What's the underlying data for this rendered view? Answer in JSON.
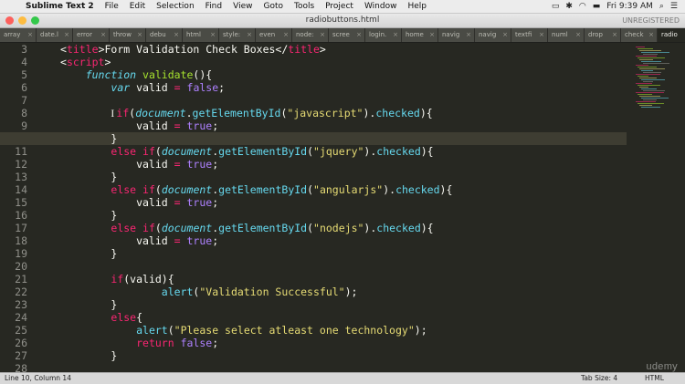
{
  "menubar": {
    "apple_icon": "apple-logo",
    "items": [
      "Sublime Text 2",
      "File",
      "Edit",
      "Selection",
      "Find",
      "View",
      "Goto",
      "Tools",
      "Project",
      "Window",
      "Help"
    ],
    "clock": "Fri 9:39 AM",
    "status_icons": [
      "display-icon",
      "bluetooth-icon",
      "wifi-icon",
      "battery-icon",
      "search-icon",
      "list-icon"
    ]
  },
  "window": {
    "title": "radiobuttons.html",
    "registration": "UNREGISTERED",
    "traffic_lights": {
      "close": "#fc605c",
      "minimize": "#fdbc40",
      "zoom": "#34c84a"
    }
  },
  "tabs": [
    {
      "label": "array",
      "active": false
    },
    {
      "label": "date.l",
      "active": false
    },
    {
      "label": "error",
      "active": false
    },
    {
      "label": "throw",
      "active": false
    },
    {
      "label": "debu",
      "active": false
    },
    {
      "label": "html",
      "active": false
    },
    {
      "label": "style:",
      "active": false
    },
    {
      "label": "even",
      "active": false
    },
    {
      "label": "node:",
      "active": false
    },
    {
      "label": "scree",
      "active": false
    },
    {
      "label": "login.",
      "active": false
    },
    {
      "label": "home",
      "active": false
    },
    {
      "label": "navig",
      "active": false
    },
    {
      "label": "navig",
      "active": false
    },
    {
      "label": "textfi",
      "active": false
    },
    {
      "label": "numl",
      "active": false
    },
    {
      "label": "drop",
      "active": false
    },
    {
      "label": "check",
      "active": false
    },
    {
      "label": "radio",
      "active": true
    }
  ],
  "editor": {
    "current_line": 10,
    "line_numbers": [
      3,
      4,
      5,
      6,
      7,
      8,
      9,
      10,
      11,
      12,
      13,
      14,
      15,
      16,
      17,
      18,
      19,
      20,
      21,
      22,
      23,
      24,
      25,
      26,
      27,
      28
    ],
    "colors": {
      "background": "#272822",
      "keyword": "#f92672",
      "function": "#a6e22e",
      "string": "#e6db74",
      "constant": "#ae81ff",
      "builtin": "#66d9ef"
    },
    "lines": [
      [
        {
          "t": "<",
          "c": ""
        },
        {
          "t": "title",
          "c": "tag"
        },
        {
          "t": ">Form Validation Check Boxes</",
          "c": ""
        },
        {
          "t": "title",
          "c": "tag"
        },
        {
          "t": ">",
          "c": ""
        }
      ],
      [
        {
          "t": "<",
          "c": ""
        },
        {
          "t": "script",
          "c": "tag"
        },
        {
          "t": ">",
          "c": ""
        }
      ],
      [
        {
          "t": "    ",
          "c": ""
        },
        {
          "t": "function",
          "c": "kwi"
        },
        {
          "t": " ",
          "c": ""
        },
        {
          "t": "validate",
          "c": "fn"
        },
        {
          "t": "(){",
          "c": ""
        }
      ],
      [
        {
          "t": "        ",
          "c": ""
        },
        {
          "t": "var",
          "c": "kwi"
        },
        {
          "t": " valid ",
          "c": ""
        },
        {
          "t": "=",
          "c": "kw"
        },
        {
          "t": " ",
          "c": ""
        },
        {
          "t": "false",
          "c": "con"
        },
        {
          "t": ";",
          "c": ""
        }
      ],
      [],
      [
        {
          "t": "        ",
          "c": ""
        },
        {
          "t": "I",
          "c": "caret"
        },
        {
          "t": "if",
          "c": "kw"
        },
        {
          "t": "(",
          "c": ""
        },
        {
          "t": "document",
          "c": "obj"
        },
        {
          "t": ".",
          "c": ""
        },
        {
          "t": "getElementById",
          "c": "meth"
        },
        {
          "t": "(",
          "c": ""
        },
        {
          "t": "\"javascript\"",
          "c": "str"
        },
        {
          "t": ").",
          "c": ""
        },
        {
          "t": "checked",
          "c": "meth"
        },
        {
          "t": "){",
          "c": ""
        }
      ],
      [
        {
          "t": "            valid ",
          "c": ""
        },
        {
          "t": "=",
          "c": "kw"
        },
        {
          "t": " ",
          "c": ""
        },
        {
          "t": "true",
          "c": "con"
        },
        {
          "t": ";",
          "c": ""
        }
      ],
      [
        {
          "t": "        }",
          "c": ""
        }
      ],
      [
        {
          "t": "        ",
          "c": ""
        },
        {
          "t": "else",
          "c": "kw"
        },
        {
          "t": " ",
          "c": ""
        },
        {
          "t": "if",
          "c": "kw"
        },
        {
          "t": "(",
          "c": ""
        },
        {
          "t": "document",
          "c": "obj"
        },
        {
          "t": ".",
          "c": ""
        },
        {
          "t": "getElementById",
          "c": "meth"
        },
        {
          "t": "(",
          "c": ""
        },
        {
          "t": "\"jquery\"",
          "c": "str"
        },
        {
          "t": ").",
          "c": ""
        },
        {
          "t": "checked",
          "c": "meth"
        },
        {
          "t": "){",
          "c": ""
        }
      ],
      [
        {
          "t": "            valid ",
          "c": ""
        },
        {
          "t": "=",
          "c": "kw"
        },
        {
          "t": " ",
          "c": ""
        },
        {
          "t": "true",
          "c": "con"
        },
        {
          "t": ";",
          "c": ""
        }
      ],
      [
        {
          "t": "        }",
          "c": ""
        }
      ],
      [
        {
          "t": "        ",
          "c": ""
        },
        {
          "t": "else",
          "c": "kw"
        },
        {
          "t": " ",
          "c": ""
        },
        {
          "t": "if",
          "c": "kw"
        },
        {
          "t": "(",
          "c": ""
        },
        {
          "t": "document",
          "c": "obj"
        },
        {
          "t": ".",
          "c": ""
        },
        {
          "t": "getElementById",
          "c": "meth"
        },
        {
          "t": "(",
          "c": ""
        },
        {
          "t": "\"angularjs\"",
          "c": "str"
        },
        {
          "t": ").",
          "c": ""
        },
        {
          "t": "checked",
          "c": "meth"
        },
        {
          "t": "){",
          "c": ""
        }
      ],
      [
        {
          "t": "            valid ",
          "c": ""
        },
        {
          "t": "=",
          "c": "kw"
        },
        {
          "t": " ",
          "c": ""
        },
        {
          "t": "true",
          "c": "con"
        },
        {
          "t": ";",
          "c": ""
        }
      ],
      [
        {
          "t": "        }",
          "c": ""
        }
      ],
      [
        {
          "t": "        ",
          "c": ""
        },
        {
          "t": "else",
          "c": "kw"
        },
        {
          "t": " ",
          "c": ""
        },
        {
          "t": "if",
          "c": "kw"
        },
        {
          "t": "(",
          "c": ""
        },
        {
          "t": "document",
          "c": "obj"
        },
        {
          "t": ".",
          "c": ""
        },
        {
          "t": "getElementById",
          "c": "meth"
        },
        {
          "t": "(",
          "c": ""
        },
        {
          "t": "\"nodejs\"",
          "c": "str"
        },
        {
          "t": ").",
          "c": ""
        },
        {
          "t": "checked",
          "c": "meth"
        },
        {
          "t": "){",
          "c": ""
        }
      ],
      [
        {
          "t": "            valid ",
          "c": ""
        },
        {
          "t": "=",
          "c": "kw"
        },
        {
          "t": " ",
          "c": ""
        },
        {
          "t": "true",
          "c": "con"
        },
        {
          "t": ";",
          "c": ""
        }
      ],
      [
        {
          "t": "        }",
          "c": ""
        }
      ],
      [],
      [
        {
          "t": "        ",
          "c": ""
        },
        {
          "t": "if",
          "c": "kw"
        },
        {
          "t": "(valid){",
          "c": ""
        }
      ],
      [
        {
          "t": "                ",
          "c": ""
        },
        {
          "t": "alert",
          "c": "meth"
        },
        {
          "t": "(",
          "c": ""
        },
        {
          "t": "\"Validation Successful\"",
          "c": "str"
        },
        {
          "t": ");",
          "c": ""
        }
      ],
      [
        {
          "t": "        }",
          "c": ""
        }
      ],
      [
        {
          "t": "        ",
          "c": ""
        },
        {
          "t": "else",
          "c": "kw"
        },
        {
          "t": "{",
          "c": ""
        }
      ],
      [
        {
          "t": "            ",
          "c": ""
        },
        {
          "t": "alert",
          "c": "meth"
        },
        {
          "t": "(",
          "c": ""
        },
        {
          "t": "\"Please select atleast one technology\"",
          "c": "str"
        },
        {
          "t": ");",
          "c": ""
        }
      ],
      [
        {
          "t": "            ",
          "c": ""
        },
        {
          "t": "return",
          "c": "kw"
        },
        {
          "t": " ",
          "c": ""
        },
        {
          "t": "false",
          "c": "con"
        },
        {
          "t": ";",
          "c": ""
        }
      ],
      [
        {
          "t": "        }",
          "c": ""
        }
      ],
      []
    ]
  },
  "statusbar": {
    "position": "Line 10, Column 14",
    "tab_size": "Tab Size: 4",
    "syntax": "HTML"
  },
  "watermark": "udemy"
}
